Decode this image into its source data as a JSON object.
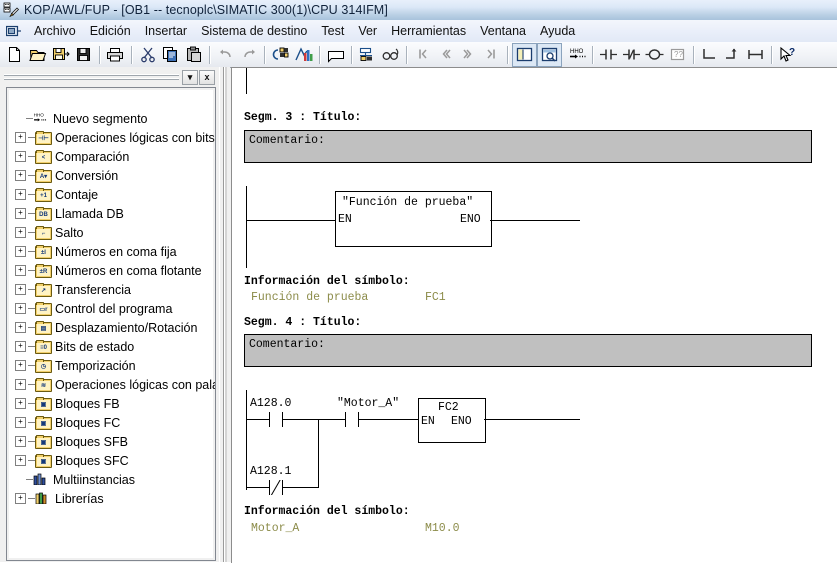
{
  "window": {
    "title": "KOP/AWL/FUP  - [OB1 -- tecnoplc\\SIMATIC 300(1)\\CPU 314IFM]",
    "app_icon": "ladder-editor-icon"
  },
  "menu": {
    "system_icon": "system-menu-icon",
    "items": [
      {
        "label": "Archivo"
      },
      {
        "label": "Edición"
      },
      {
        "label": "Insertar"
      },
      {
        "label": "Sistema de destino"
      },
      {
        "label": "Test"
      },
      {
        "label": "Ver"
      },
      {
        "label": "Herramientas"
      },
      {
        "label": "Ventana"
      },
      {
        "label": "Ayuda"
      }
    ]
  },
  "toolbar": {
    "buttons": [
      {
        "name": "new-icon",
        "tip": "Nuevo"
      },
      {
        "name": "open-folder-icon",
        "tip": "Abrir"
      },
      {
        "name": "save-as-icon",
        "tip": "Guardar como"
      },
      {
        "name": "save-floppy-icon",
        "tip": "Guardar"
      },
      {
        "name": "print-icon",
        "tip": "Imprimir"
      },
      {
        "name": "cut-scissors-icon",
        "tip": "Cortar"
      },
      {
        "name": "copy-icon",
        "tip": "Copiar"
      },
      {
        "name": "paste-icon",
        "tip": "Pegar"
      },
      {
        "name": "undo-icon",
        "tip": "Deshacer"
      },
      {
        "name": "redo-icon",
        "tip": "Rehacer"
      },
      {
        "name": "download-plc-icon",
        "tip": "Cargar en CPU"
      },
      {
        "name": "monitor-chart-icon",
        "tip": "Observar"
      },
      {
        "name": "comment-icon",
        "tip": "Comentario"
      },
      {
        "name": "symbol-table-icon",
        "tip": "Tabla de símbolos"
      },
      {
        "name": "glasses-overview-icon",
        "tip": "Vista general"
      },
      {
        "name": "first-segment-icon",
        "tip": "Primer segmento"
      },
      {
        "name": "prev-segment-icon",
        "tip": "Segmento anterior"
      },
      {
        "name": "next-segment-icon",
        "tip": "Segmento siguiente"
      },
      {
        "name": "last-segment-icon",
        "tip": "Último segmento"
      },
      {
        "name": "layout-pane-icon",
        "tip": "Ventana"
      },
      {
        "name": "zoom-pane-icon",
        "tip": "Zoom"
      },
      {
        "name": "new-network-icon",
        "tip": "Nuevo segmento"
      },
      {
        "name": "contact-no-icon",
        "tip": "Contacto normalmente abierto"
      },
      {
        "name": "contact-nc-icon",
        "tip": "Contacto normalmente cerrado"
      },
      {
        "name": "coil-output-icon",
        "tip": "Bobina"
      },
      {
        "name": "empty-box-icon",
        "tip": "Cuadro vacío"
      },
      {
        "name": "branch-open-icon",
        "tip": "Abrir rama"
      },
      {
        "name": "branch-close-icon",
        "tip": "Cerrar rama"
      },
      {
        "name": "branch-parallel-icon",
        "tip": "Rama paralela"
      },
      {
        "name": "help-pointer-icon",
        "tip": "Ayuda contextual"
      }
    ],
    "selected_index": 20
  },
  "left_panel": {
    "dropdown_icon": "chevron-down-icon",
    "close_label": "x",
    "tree": [
      {
        "label": "Nuevo segmento",
        "icon": "new-network-icon",
        "expandable": false
      },
      {
        "label": "Operaciones lógicas con bits",
        "icon": "bit-logic-icon",
        "expandable": true
      },
      {
        "label": "Comparación",
        "icon": "compare-icon",
        "expandable": true
      },
      {
        "label": "Conversión",
        "icon": "convert-icon",
        "expandable": true
      },
      {
        "label": "Contaje",
        "icon": "counter-icon",
        "expandable": true
      },
      {
        "label": "Llamada DB",
        "icon": "db-call-icon",
        "expandable": true
      },
      {
        "label": "Salto",
        "icon": "jump-icon",
        "expandable": true
      },
      {
        "label": "Números en coma fija",
        "icon": "fixed-point-icon",
        "expandable": true
      },
      {
        "label": "Números en coma flotante",
        "icon": "float-point-icon",
        "expandable": true
      },
      {
        "label": "Transferencia",
        "icon": "move-icon",
        "expandable": true
      },
      {
        "label": "Control del programa",
        "icon": "program-ctrl-icon",
        "expandable": true
      },
      {
        "label": "Desplazamiento/Rotación",
        "icon": "shift-rotate-icon",
        "expandable": true
      },
      {
        "label": "Bits de estado",
        "icon": "status-bits-icon",
        "expandable": true
      },
      {
        "label": "Temporización",
        "icon": "timer-icon",
        "expandable": true
      },
      {
        "label": "Operaciones lógicas con palab",
        "icon": "word-logic-icon",
        "expandable": true
      },
      {
        "label": "Bloques FB",
        "icon": "fb-block-icon",
        "expandable": true
      },
      {
        "label": "Bloques FC",
        "icon": "fc-block-icon",
        "expandable": true
      },
      {
        "label": "Bloques SFB",
        "icon": "sfb-block-icon",
        "expandable": true
      },
      {
        "label": "Bloques SFC",
        "icon": "sfc-block-icon",
        "expandable": true
      },
      {
        "label": "Multiinstancias",
        "icon": "multi-instance-icon",
        "expandable": false
      },
      {
        "label": "Librerías",
        "icon": "libraries-icon",
        "expandable": true
      }
    ]
  },
  "editor": {
    "segment3": {
      "title": "Segm.  3 : Título:",
      "comment": "Comentario:",
      "block_name": "\"Función de prueba\"",
      "en": "EN",
      "eno": "ENO",
      "symbol_header": "Información del símbolo:",
      "symbol_name": "Función de prueba",
      "symbol_addr": "FC1"
    },
    "segment4": {
      "title": "Segm.  4 : Título:",
      "comment": "Comentario:",
      "contact1": "A128.0",
      "contact2": "A128.1",
      "contact3": "\"Motor_A\"",
      "block_name": "FC2",
      "en": "EN",
      "eno": "ENO",
      "symbol_header": "Información del símbolo:",
      "symbol_name": "Motor_A",
      "symbol_addr": "M10.0"
    }
  },
  "colors": {
    "symbol_text": "#8c8c4a",
    "comment_box": "#c0c0c0",
    "titlebar_start": "#e8f0fb",
    "titlebar_end": "#a8c3dc",
    "folder_icon": "#f2d06b"
  }
}
